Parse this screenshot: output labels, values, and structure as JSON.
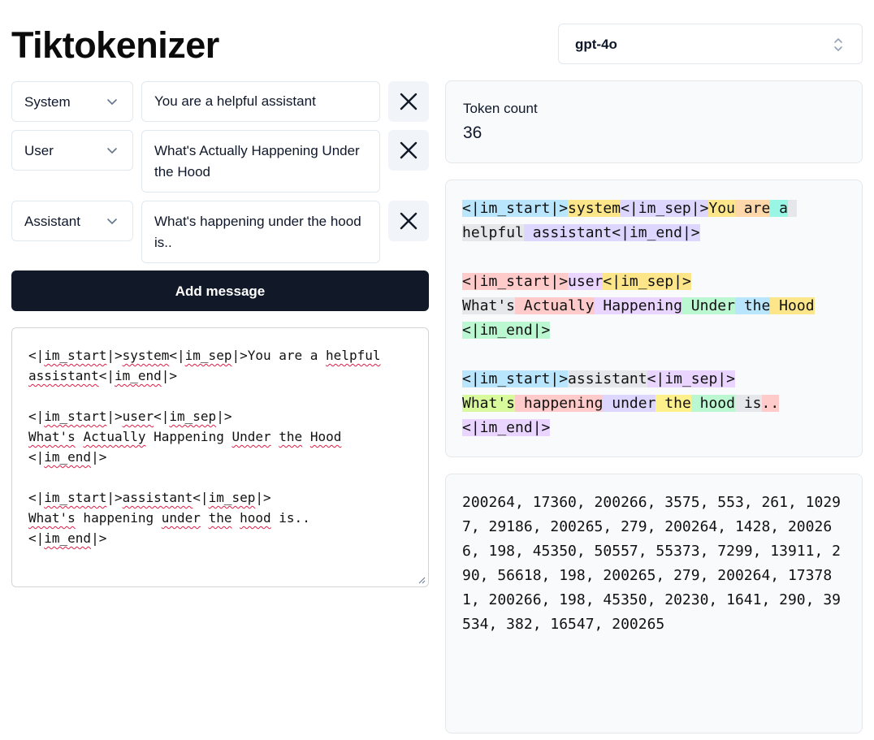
{
  "app": {
    "title": "Tiktokenizer"
  },
  "model": {
    "selected": "gpt-4o"
  },
  "messages": [
    {
      "role": "System",
      "content": "You are a helpful assistant"
    },
    {
      "role": "User",
      "content": "What's Actually Happening Under the Hood"
    },
    {
      "role": "Assistant",
      "content": "What's happening under the hood is.."
    }
  ],
  "add_message_label": "Add message",
  "raw_prompt": {
    "l1a": "<|",
    "l1b": "im_start",
    "l1c": "|>",
    "l1d": "system",
    "l1e": "<|",
    "l1f": "im_sep",
    "l1g": "|>You are a ",
    "l1h": "helpful",
    "l2a": "assistant",
    "l2b": "<|",
    "l2c": "im_end",
    "l2d": "|>",
    "l3a": "<|",
    "l3b": "im_start",
    "l3c": "|>",
    "l3d": "user",
    "l3e": "<|",
    "l3f": "im_sep",
    "l3g": "|>",
    "l4a": "What's",
    "l4b": " ",
    "l4c": "Actually",
    "l4d": " Happening ",
    "l4e": "Under",
    "l4f": " ",
    "l4g": "the",
    "l4h": " ",
    "l4i": "Hood",
    "l5a": "<|",
    "l5b": "im_end",
    "l5c": "|>",
    "l6a": "<|",
    "l6b": "im_start",
    "l6c": "|>",
    "l6d": "assistant",
    "l6e": "<|",
    "l6f": "im_sep",
    "l6g": "|>",
    "l7a": "What's",
    "l7b": " happening ",
    "l7c": "under",
    "l7d": " ",
    "l7e": "the",
    "l7f": " ",
    "l7g": "hood",
    "l7h": " is..",
    "l8a": "<|",
    "l8b": "im_end",
    "l8c": "|>"
  },
  "token_count": {
    "label": "Token count",
    "value": "36"
  },
  "tokens_visual": [
    {
      "text": "<|im_start|>",
      "color": "#bae6fd"
    },
    {
      "text": "system",
      "color": "#fde68a"
    },
    {
      "text": "<|im_sep|>",
      "color": "#ddd6fe"
    },
    {
      "text": "You",
      "color": "#fde68a"
    },
    {
      "text": " are",
      "color": "#fed7aa"
    },
    {
      "text": " a",
      "color": "#99f6e4"
    },
    {
      "text": " help",
      "color": "#e5e7eb"
    },
    {
      "text": "ful",
      "color": "#e5e7eb"
    },
    {
      "text": " assistant",
      "color": "#ddd6fe"
    },
    {
      "text": "<|im_end|>",
      "color": "#ddd6fe"
    },
    {
      "text": "\n\n",
      "color": ""
    },
    {
      "text": "<|im_start|>",
      "color": "#fecaca"
    },
    {
      "text": "user",
      "color": "#e9d5ff"
    },
    {
      "text": "<|im_sep|>",
      "color": "#fde68a"
    },
    {
      "text": "\n",
      "color": ""
    },
    {
      "text": "What's",
      "color": "#e5e7eb"
    },
    {
      "text": " Actually",
      "color": "#fecaca"
    },
    {
      "text": " Happening",
      "color": "#e9d5ff"
    },
    {
      "text": " Under",
      "color": "#bbf7d0"
    },
    {
      "text": " the",
      "color": "#bae6fd"
    },
    {
      "text": " Hood",
      "color": "#fde68a"
    },
    {
      "text": "\n",
      "color": ""
    },
    {
      "text": "<|im_end|>",
      "color": "#bbf7d0"
    },
    {
      "text": "\n\n",
      "color": ""
    },
    {
      "text": "<|im_start|>",
      "color": "#bae6fd"
    },
    {
      "text": "assistant",
      "color": "#e5e7eb"
    },
    {
      "text": "<|im_sep|>",
      "color": "#e9d5ff"
    },
    {
      "text": "\n",
      "color": ""
    },
    {
      "text": "What's",
      "color": "#d9f99d"
    },
    {
      "text": " happening",
      "color": "#fecaca"
    },
    {
      "text": " under",
      "color": "#ddd6fe"
    },
    {
      "text": " the",
      "color": "#fef08a"
    },
    {
      "text": " hood",
      "color": "#bbf7d0"
    },
    {
      "text": " is",
      "color": "#e5e7eb"
    },
    {
      "text": "..",
      "color": "#fecaca"
    },
    {
      "text": "\n",
      "color": ""
    },
    {
      "text": "<|im_end|>",
      "color": "#e9d5ff"
    }
  ],
  "token_ids": "200264, 17360, 200266, 3575, 553, 261, 10297, 29186, 200265, 279, 200264, 1428, 200266, 198, 45350, 50557, 55373, 7299, 13911, 290, 56618, 198, 200265, 279, 200264, 173781, 200266, 198, 45350, 20230, 1641, 290, 39534, 382, 16547, 200265"
}
